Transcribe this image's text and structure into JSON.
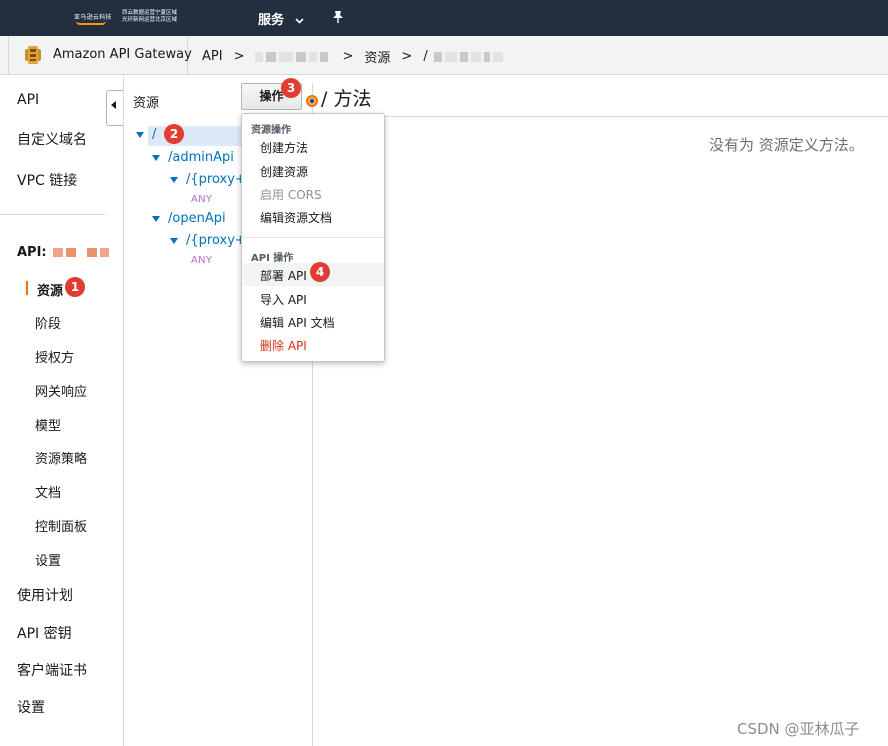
{
  "topbar": {
    "logo_line1": "亚马逊云科技",
    "logo_line2a": "西云数据运营宁夏区域",
    "logo_line2b": "光环新网运营北京区域",
    "services_label": "服务",
    "services_icon": "chevron-down-icon",
    "pin_icon": "pin-icon"
  },
  "breadcrumb": {
    "service_name": "Amazon API Gateway",
    "items": [
      "API",
      ">",
      ">",
      "资源",
      ">",
      "/"
    ]
  },
  "leftnav": {
    "items_top": [
      "API",
      "自定义域名",
      "VPC 链接"
    ],
    "api_prefix": "API:",
    "sub_items": [
      "资源",
      "阶段",
      "授权方",
      "网关响应",
      "模型",
      "资源策略",
      "文档",
      "控制面板",
      "设置"
    ],
    "items_bottom": [
      "使用计划",
      "API 密钥",
      "客户端证书",
      "设置"
    ],
    "collapse_icon": "caret-left-icon"
  },
  "resources": {
    "title": "资源",
    "actions_button": "操作",
    "tree": [
      {
        "path": "/",
        "level": 0
      },
      {
        "path": "/adminApi",
        "level": 1
      },
      {
        "path": "/{proxy+}",
        "level": 2,
        "method": "ANY"
      },
      {
        "path": "/openApi",
        "level": 1
      },
      {
        "path": "/{proxy+}",
        "level": 2,
        "method": "ANY"
      }
    ]
  },
  "main": {
    "title": "/ 方法",
    "empty_message": "没有为 资源定义方法。"
  },
  "dropdown": {
    "resource_group": "资源操作",
    "resource_items": [
      "创建方法",
      "创建资源",
      "启用 CORS",
      "编辑资源文档"
    ],
    "api_group": "API 操作",
    "api_items": [
      "部署 API",
      "导入 API",
      "编辑 API 文档",
      "删除 API"
    ]
  },
  "badges": [
    "1",
    "2",
    "3",
    "4"
  ],
  "watermark": "CSDN @亚林瓜子",
  "colors": {
    "topbar": "#232f3e",
    "link": "#0073bb",
    "accent": "#ec7211",
    "badge": "#e03c31",
    "danger": "#d13212"
  }
}
